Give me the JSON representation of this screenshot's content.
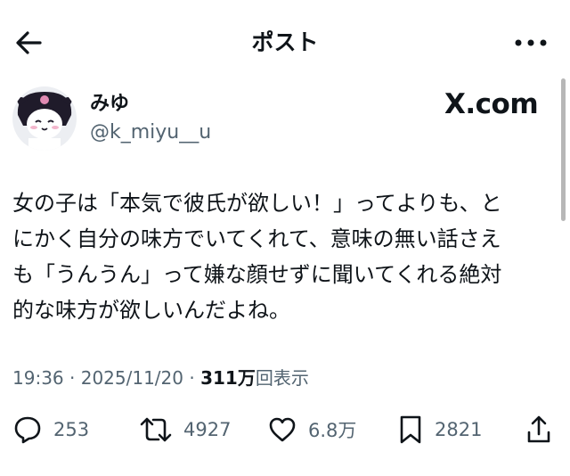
{
  "header": {
    "title": "ポスト"
  },
  "author": {
    "name": "みゆ",
    "handle": "@k_miyu__u",
    "source": "X.com"
  },
  "post": {
    "lines": [
      "女の子は「本気で彼氏が欲しい！」ってよりも、と",
      "にかく自分の味方でいてくれて、意味の無い話さえ",
      "も「うんうん」って嫌な顔せずに聞いてくれる絶対",
      "的な味方が欲しいんだよね。"
    ],
    "time": "19:36",
    "date": "2025/11/20",
    "views_count": "311万",
    "views_label": "回表示"
  },
  "actions": {
    "replies": "253",
    "reposts": "4927",
    "likes": "6.8万",
    "bookmarks": "2821"
  },
  "icons": [
    "back-arrow-icon",
    "more-options-icon",
    "reply-icon",
    "repost-icon",
    "like-icon",
    "bookmark-icon",
    "share-icon"
  ]
}
